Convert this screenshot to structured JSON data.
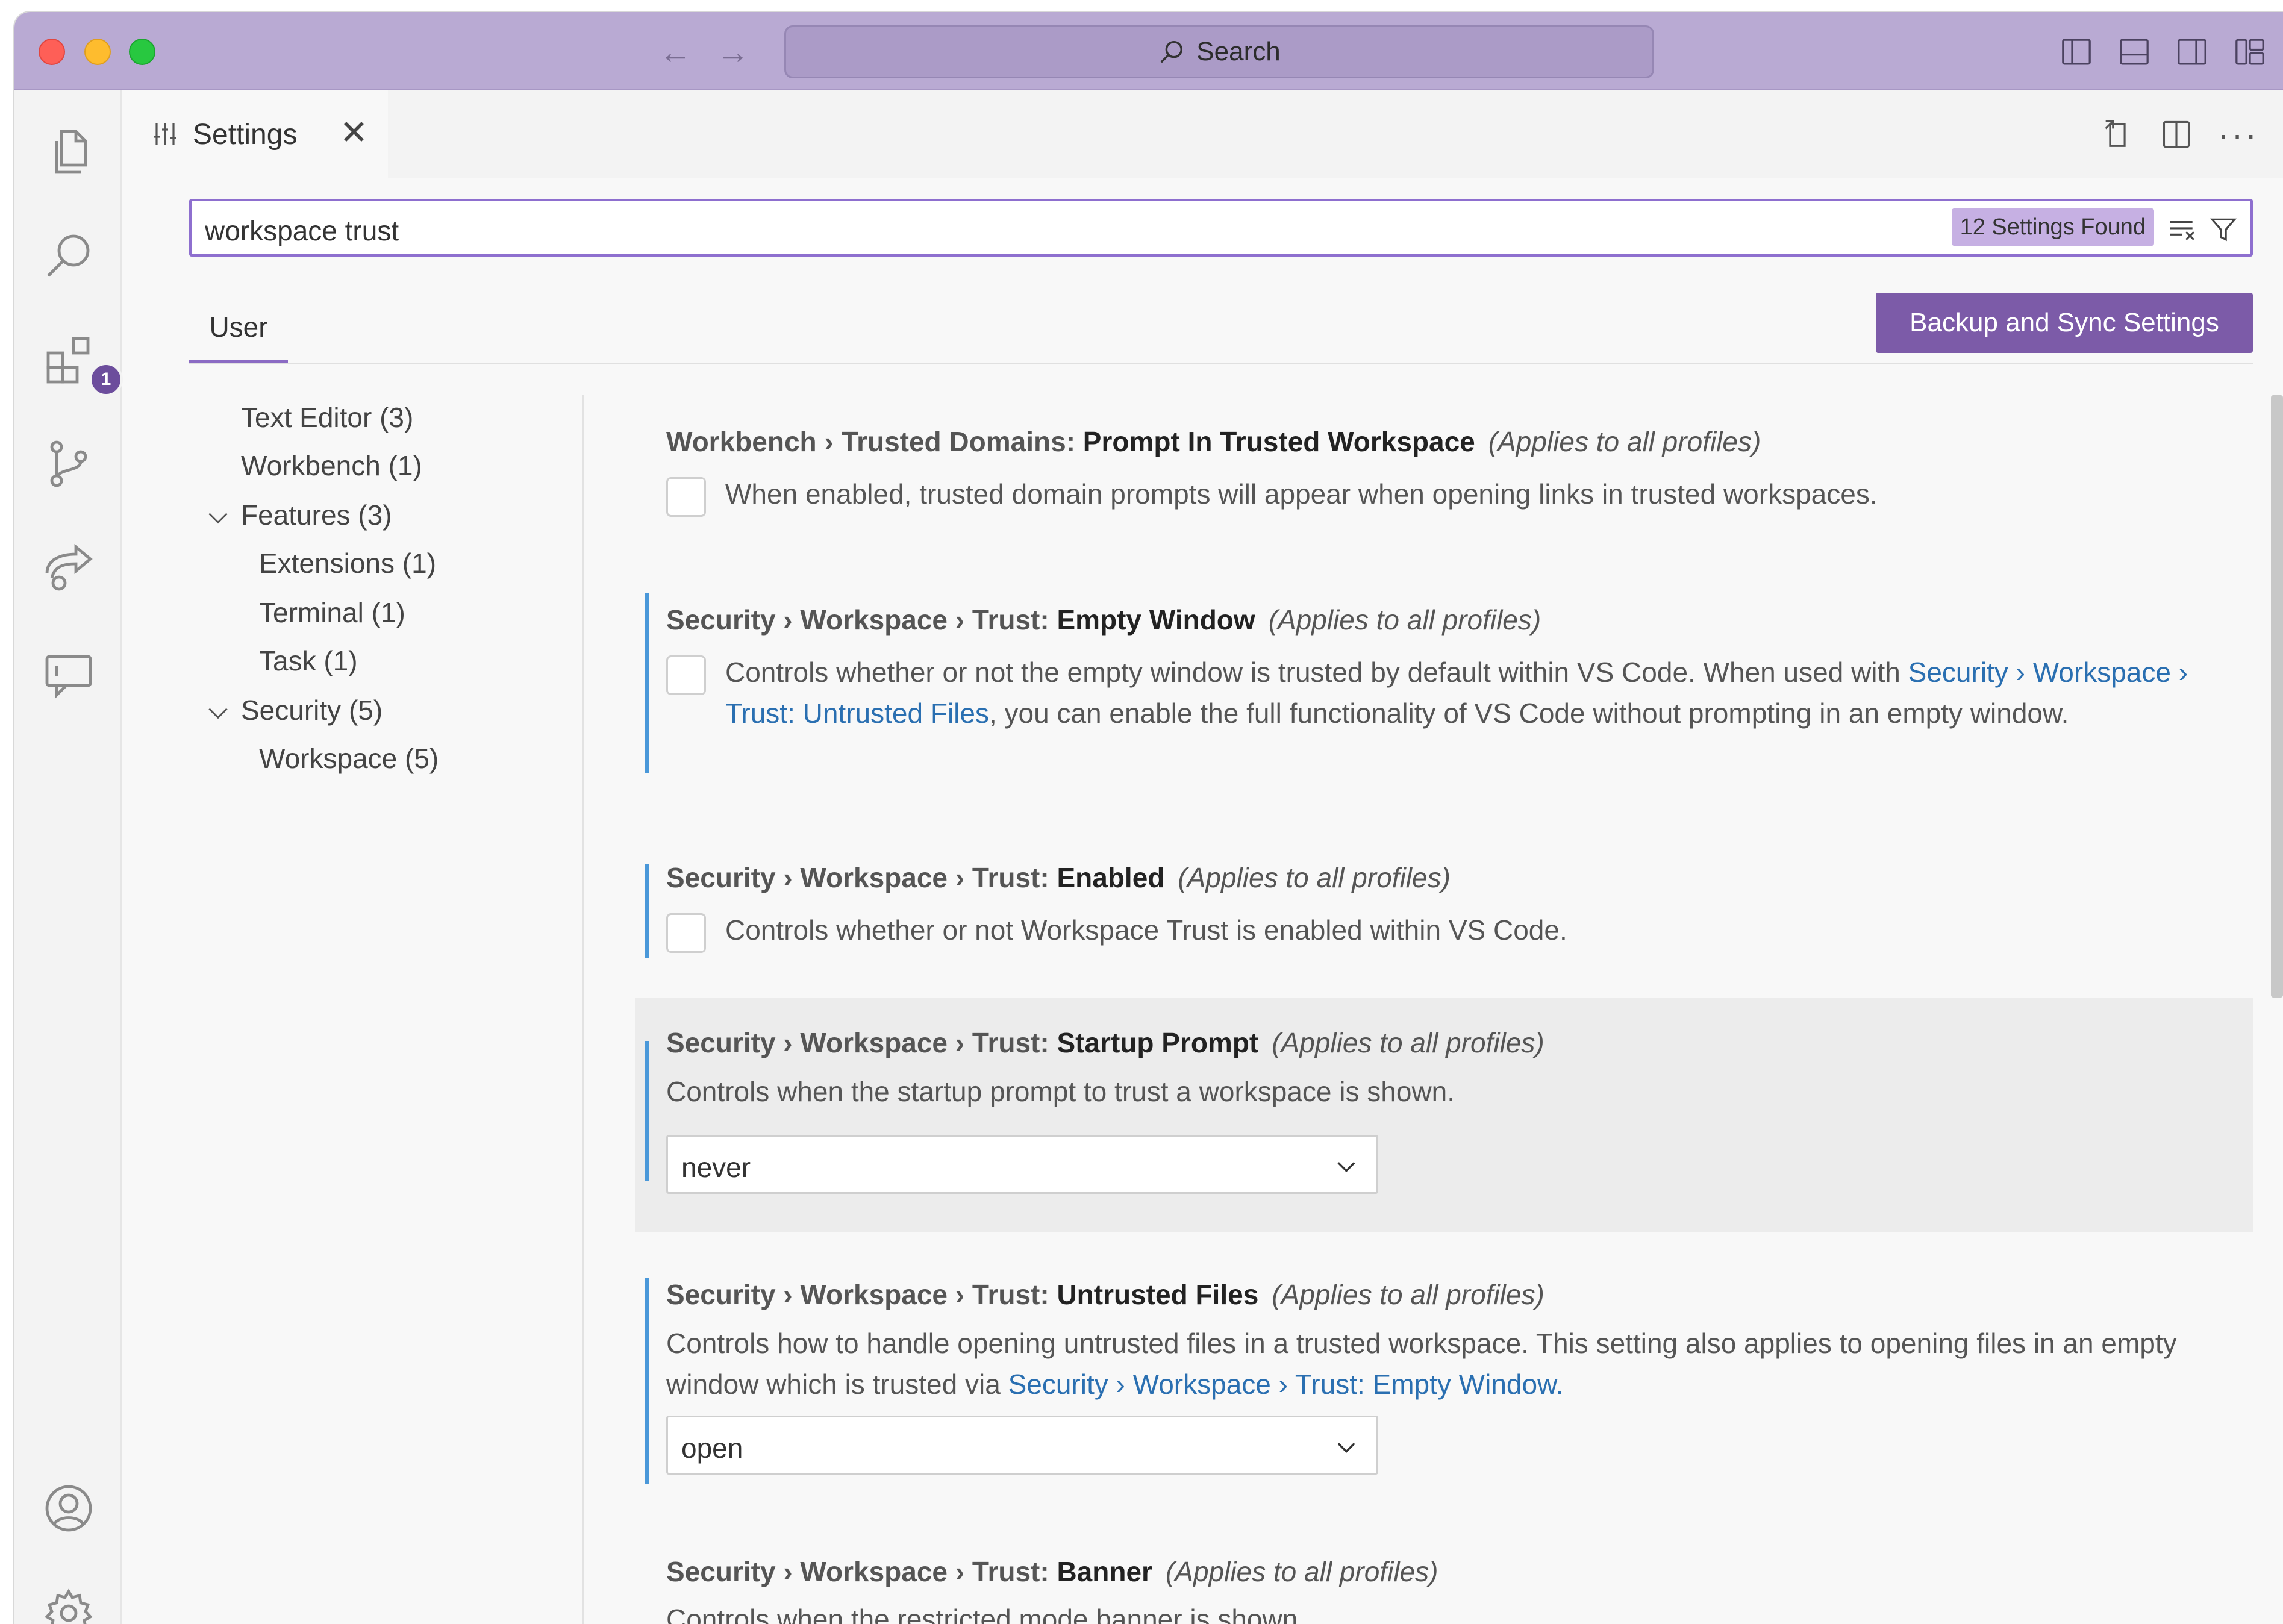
{
  "titlebar": {
    "search_label": "Search",
    "nav_back": "←",
    "nav_forward": "→"
  },
  "activity_bar": {
    "icons": [
      "files-icon",
      "search-icon",
      "extensions-icon",
      "source-control-icon",
      "remote-icon",
      "chat-icon",
      "account-icon",
      "manage-gear-icon"
    ],
    "extensions_badge": "1"
  },
  "editor": {
    "tab_label": "Settings",
    "tab_close": "✕"
  },
  "settings": {
    "search_value": "workspace trust",
    "results_count": "12 Settings Found",
    "scope_tab": "User",
    "sync_button": "Backup and Sync Settings",
    "toc": [
      {
        "label": "Text Editor (3)"
      },
      {
        "label": "Workbench (1)"
      },
      {
        "label": "Features (3)"
      },
      {
        "label": "Extensions (1)"
      },
      {
        "label": "Terminal (1)"
      },
      {
        "label": "Task (1)"
      },
      {
        "label": "Security (5)"
      },
      {
        "label": "Workspace (5)"
      }
    ],
    "items": [
      {
        "category": "Workbench › Trusted Domains: ",
        "name": "Prompt In Trusted Workspace",
        "note": "(Applies to all profiles)",
        "description": "When enabled, trusted domain prompts will appear when opening links in trusted workspaces."
      },
      {
        "category": "Security › Workspace › Trust: ",
        "name": "Empty Window",
        "note": "(Applies to all profiles)",
        "desc_part1": "Controls whether or not the empty window is trusted by default within VS Code. When used with ",
        "desc_link": "Security › Workspace › Trust: Untrusted Files",
        "desc_part2": ", you can enable the full functionality of VS Code without prompting in an empty window."
      },
      {
        "category": "Security › Workspace › Trust: ",
        "name": "Enabled",
        "note": "(Applies to all profiles)",
        "description": "Controls whether or not Workspace Trust is enabled within VS Code."
      },
      {
        "category": "Security › Workspace › Trust: ",
        "name": "Startup Prompt",
        "note": "(Applies to all profiles)",
        "description": "Controls when the startup prompt to trust a workspace is shown.",
        "value": "never"
      },
      {
        "category": "Security › Workspace › Trust: ",
        "name": "Untrusted Files",
        "note": "(Applies to all profiles)",
        "desc_part1": "Controls how to handle opening untrusted files in a trusted workspace. This setting also applies to opening files in an empty window which is trusted via ",
        "desc_link": "Security › Workspace › Trust: Empty Window",
        "desc_part2": ".",
        "value": "open"
      },
      {
        "category": "Security › Workspace › Trust: ",
        "name": "Banner",
        "note": "(Applies to all profiles)",
        "description": "Controls when the restricted mode banner is shown."
      }
    ]
  }
}
